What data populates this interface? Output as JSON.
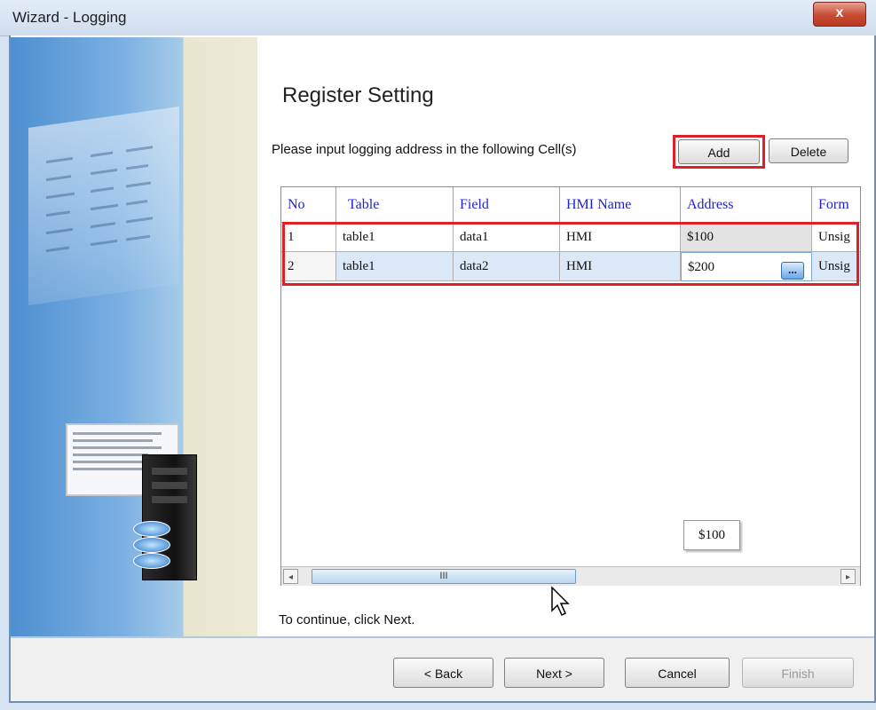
{
  "window": {
    "title": "Wizard - Logging",
    "close_label": "x"
  },
  "page": {
    "heading": "Register Setting",
    "prompt": "Please input logging address in the following Cell(s)",
    "add_label": "Add",
    "delete_label": "Delete"
  },
  "grid": {
    "columns": [
      "No",
      "Table",
      "Field",
      "HMI Name",
      "Address",
      "Form"
    ],
    "rows": [
      {
        "no": "1",
        "table": "table1",
        "field": "data1",
        "hmi_name": "HMI",
        "address": "$100",
        "format": "Unsig"
      },
      {
        "no": "2",
        "table": "table1",
        "field": "data2",
        "hmi_name": "HMI",
        "address": "$200",
        "format": "Unsig"
      }
    ],
    "ellipsis_label": "...",
    "tooltip": "$100",
    "scroll_thumb_label": "III",
    "scroll_left": "◂",
    "scroll_right": "▸"
  },
  "status": {
    "continue_text": "To continue, click Next."
  },
  "footer": {
    "back_label": "< Back",
    "next_label": "Next >",
    "cancel_label": "Cancel",
    "finish_label": "Finish"
  },
  "colors": {
    "highlight": "#e01f26",
    "header_text": "#2222cc",
    "selected_row": "#dbe8f8"
  }
}
